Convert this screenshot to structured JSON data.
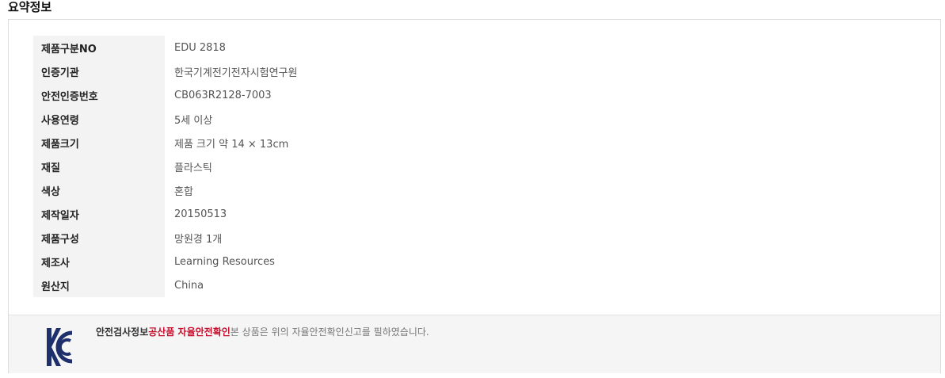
{
  "section": {
    "title": "요약정보"
  },
  "specs": [
    {
      "label": "제품구분NO",
      "value": "EDU 2818"
    },
    {
      "label": "인증기관",
      "value": "한국기계전기전자시험연구원"
    },
    {
      "label": "안전인증번호",
      "value": "CB063R2128-7003"
    },
    {
      "label": "사용연령",
      "value": "5세 이상"
    },
    {
      "label": "제품크기",
      "value": "제품 크기 약 14 × 13cm"
    },
    {
      "label": "재질",
      "value": "플라스틱"
    },
    {
      "label": "색상",
      "value": "혼합"
    },
    {
      "label": "제작일자",
      "value": "20150513"
    },
    {
      "label": "제품구성",
      "value": "망원경 1개"
    },
    {
      "label": "제조사",
      "value": "Learning Resources"
    },
    {
      "label": "원산지",
      "value": "China"
    }
  ],
  "certification": {
    "logo_icon": "kc-mark-icon",
    "heading": "안전검사정보",
    "category": "공산품 자율안전확인",
    "statement": "본 상품은 위의 자율안전확인신고를 필하였습니다.",
    "accent_color": "#c8102e"
  }
}
